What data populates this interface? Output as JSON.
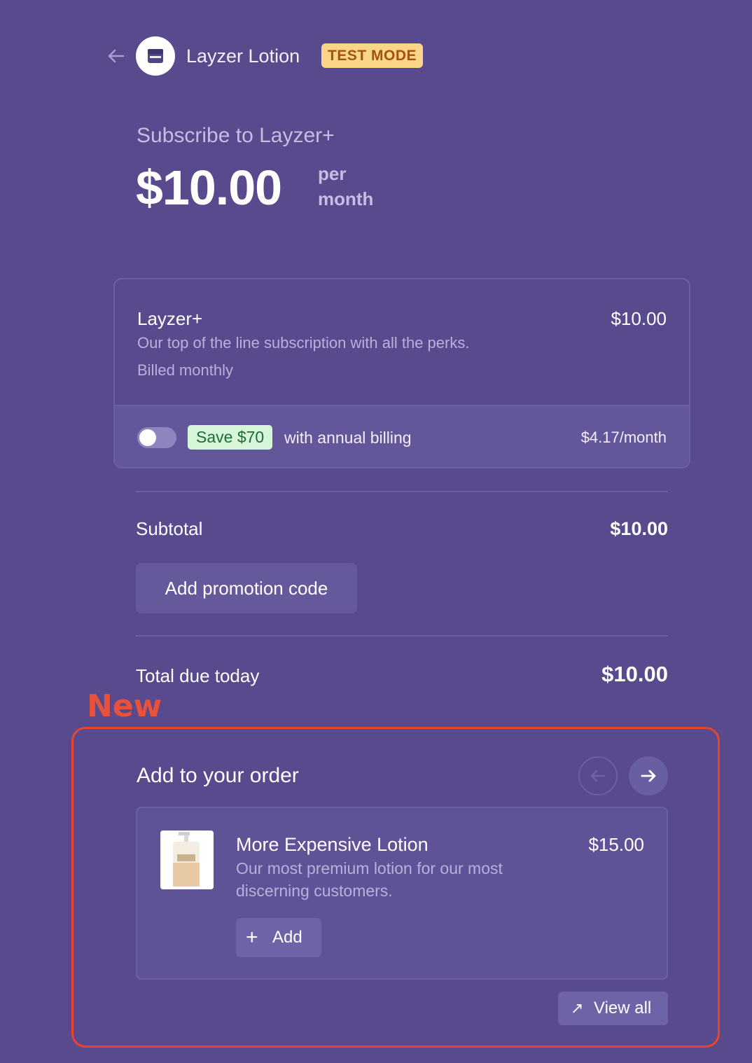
{
  "header": {
    "brand_name": "Layzer Lotion",
    "test_mode_badge": "TEST MODE"
  },
  "subscription": {
    "title": "Subscribe to Layzer+",
    "price": "$10.00",
    "period_line1": "per",
    "period_line2": "month"
  },
  "line_item": {
    "name": "Layzer+",
    "description": "Our top of the line subscription with all the perks.",
    "billing": "Billed monthly",
    "price": "$10.00",
    "annual_toggle_on": false,
    "save_badge": "Save $70",
    "annual_text": "with annual billing",
    "annual_price": "$4.17/month"
  },
  "summary": {
    "subtotal_label": "Subtotal",
    "subtotal_value": "$10.00",
    "promo_button": "Add promotion code",
    "total_label": "Total due today",
    "total_value": "$10.00"
  },
  "annotation": {
    "note": "New",
    "color": "#e8442e"
  },
  "upsell": {
    "title": "Add to your order",
    "product_name": "More Expensive Lotion",
    "product_description": "Our most premium lotion for our most discerning customers.",
    "product_price": "$15.00",
    "add_button": "Add",
    "view_all_button": "View all"
  },
  "colors": {
    "background": "#584a8c",
    "badge_test": "#fbd58a",
    "badge_save": "#d6f5d9"
  }
}
